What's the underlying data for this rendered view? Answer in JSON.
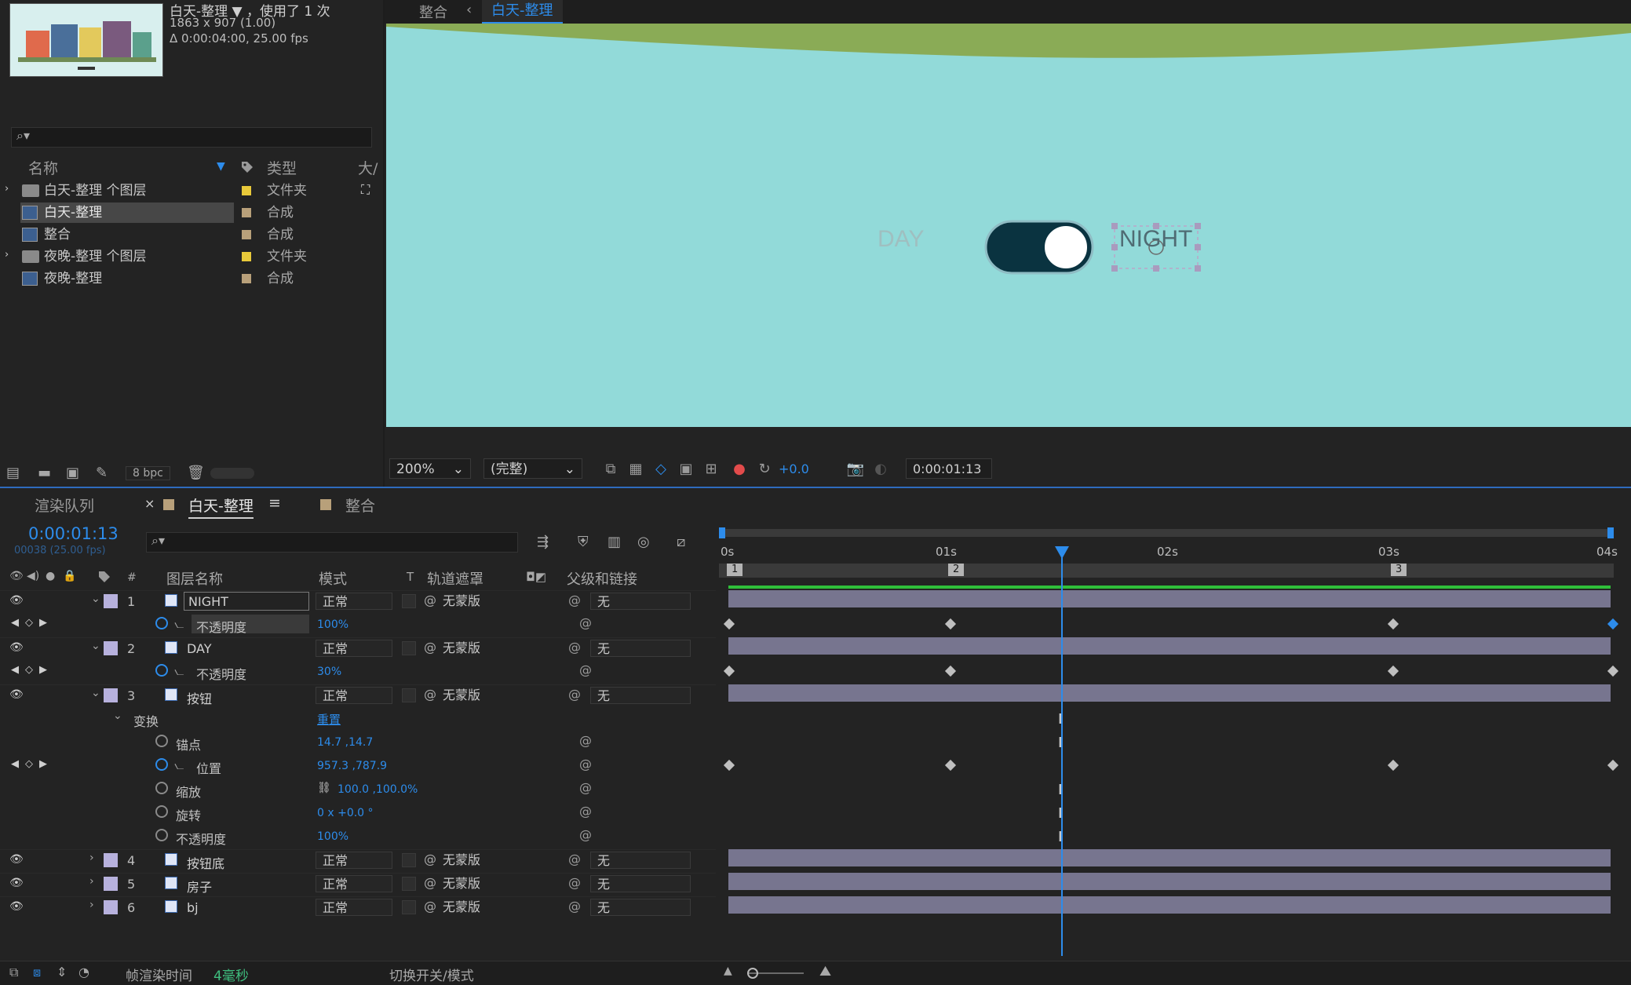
{
  "project_panel": {
    "comp_name": "白天-整理",
    "usage": "，使用了 1 次",
    "dimensions": "1863 x 907 (1.00)",
    "duration": "Δ 0:00:04:00, 25.00 fps",
    "columns": {
      "name": "名称",
      "type": "类型",
      "size": "大/"
    },
    "items": [
      {
        "label": "白天-整理 个图层",
        "type": "文件夹",
        "icon": "folder-icon",
        "color": "#e8c93a"
      },
      {
        "label": "白天-整理",
        "type": "合成",
        "icon": "composition-icon",
        "color": "#b8a07a"
      },
      {
        "label": "整合",
        "type": "合成",
        "icon": "composition-icon",
        "color": "#b8a07a"
      },
      {
        "label": "夜晚-整理 个图层",
        "type": "文件夹",
        "icon": "folder-icon",
        "color": "#e8c93a"
      },
      {
        "label": "夜晚-整理",
        "type": "合成",
        "icon": "composition-icon",
        "color": "#b8a07a"
      }
    ],
    "bpc": "8 bpc"
  },
  "viewer": {
    "breadcrumbs": [
      "整合",
      "白天-整理"
    ],
    "canvas": {
      "day_label": "DAY",
      "night_label": "NIGHT"
    },
    "zoom": "200%",
    "resolution": "(完整)",
    "exposure": "+0.0",
    "current_time": "0:00:01:13"
  },
  "timeline": {
    "tabs": {
      "render_queue": "渲染队列",
      "active": "白天-整理",
      "other": "整合"
    },
    "timecode": "0:00:01:13",
    "frame_info": "00038 (25.00 fps)",
    "headers": {
      "num": "#",
      "layer_name": "图层名称",
      "mode": "模式",
      "t": "T",
      "matte": "轨道遮罩",
      "parent": "父级和链接"
    },
    "ruler": [
      "0s",
      "01s",
      "02s",
      "03s",
      "04s"
    ],
    "markers": [
      "1",
      "2",
      "3"
    ],
    "layers": [
      {
        "num": "1",
        "name": "NIGHT",
        "mode": "正常",
        "matte": "无蒙版",
        "parent": "无"
      },
      {
        "num": "2",
        "name": "DAY",
        "mode": "正常",
        "matte": "无蒙版",
        "parent": "无"
      },
      {
        "num": "3",
        "name": "按钮",
        "mode": "正常",
        "matte": "无蒙版",
        "parent": "无"
      },
      {
        "num": "4",
        "name": "按钮底",
        "mode": "正常",
        "matte": "无蒙版",
        "parent": "无"
      },
      {
        "num": "5",
        "name": "房子",
        "mode": "正常",
        "matte": "无蒙版",
        "parent": "无"
      },
      {
        "num": "6",
        "name": "bj",
        "mode": "正常",
        "matte": "无蒙版",
        "parent": "无"
      }
    ],
    "props": {
      "opacity_label": "不透明度",
      "night_opacity": "100%",
      "day_opacity": "30%",
      "transform_label": "变换",
      "reset": "重置",
      "anchor_label": "锚点",
      "anchor_value": "14.7 ,14.7",
      "position_label": "位置",
      "position_value": "957.3 ,787.9",
      "scale_label": "缩放",
      "scale_value": "100.0 ,100.0%",
      "rotation_label": "旋转",
      "rotation_value": "0 x +0.0 °",
      "opacity3_value": "100%"
    },
    "footer": {
      "render_time_label": "帧渲染时间",
      "render_time_value": "4毫秒",
      "toggle": "切换开关/模式"
    }
  }
}
